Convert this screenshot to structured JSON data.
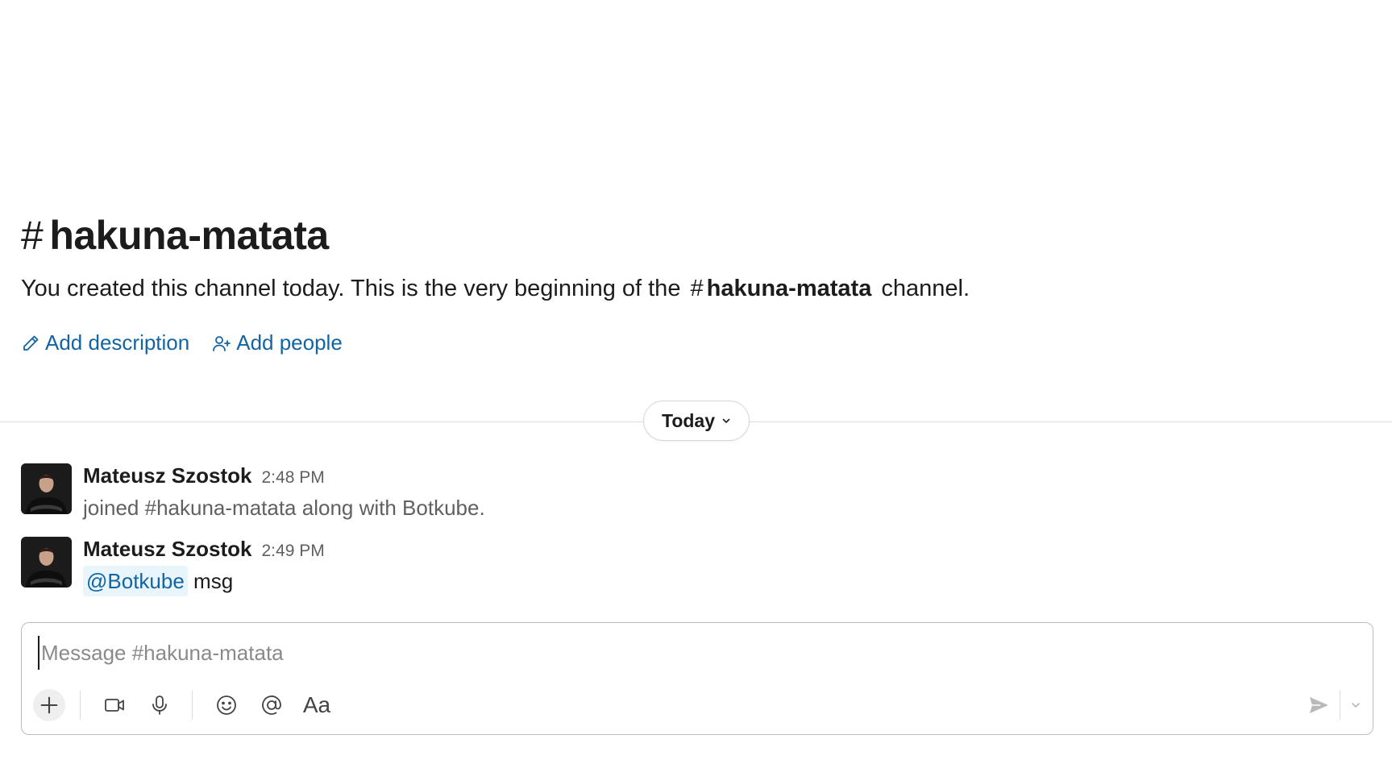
{
  "channel": {
    "hash": "#",
    "name": "hakuna-matata"
  },
  "intro": {
    "description_before": "You created this channel today. This is the very beginning of the",
    "channel_hash": "#",
    "channel_name": "hakuna-matata",
    "description_after": "channel.",
    "add_description_label": "Add description",
    "add_people_label": "Add people"
  },
  "divider": {
    "label": "Today"
  },
  "messages": [
    {
      "author": "Mateusz Szostok",
      "time": "2:48 PM",
      "text": "joined #hakuna-matata along with Botkube."
    },
    {
      "author": "Mateusz Szostok",
      "time": "2:49 PM",
      "mention": "@Botkube",
      "text": "msg"
    }
  ],
  "composer": {
    "placeholder": "Message #hakuna-matata",
    "format_label": "Aa",
    "icons": [
      "plus-icon",
      "video-icon",
      "microphone-icon",
      "emoji-icon",
      "at-mention-icon",
      "send-icon",
      "chevron-down-icon"
    ]
  },
  "colors": {
    "link": "#1264a3",
    "mention_bg": "#e8f5fa",
    "text": "#1d1c1d",
    "muted": "#616061"
  }
}
